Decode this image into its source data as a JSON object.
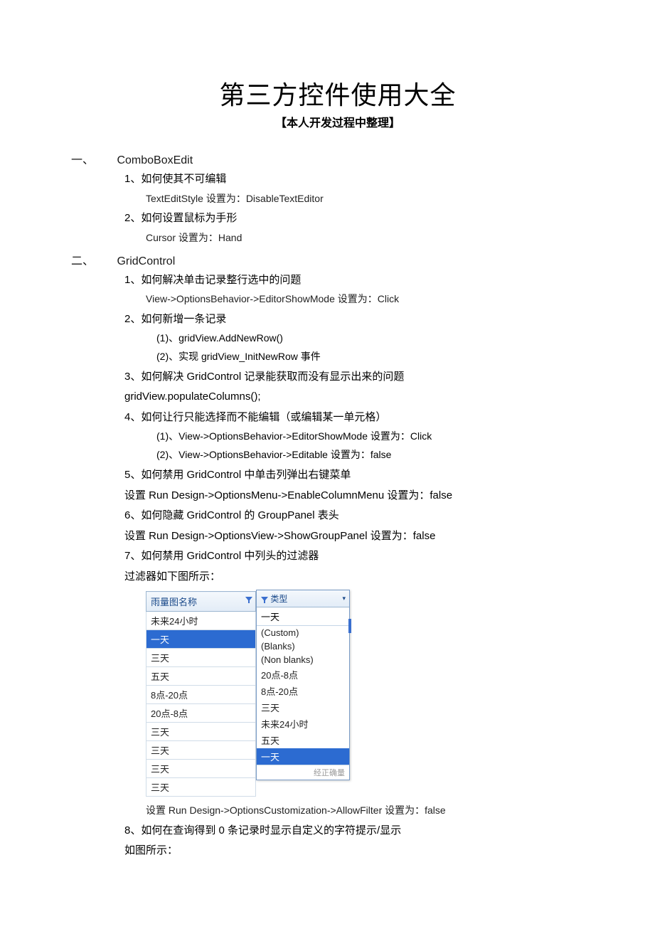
{
  "title": "第三方控件使用大全",
  "subtitle": "【本人开发过程中整理】",
  "sections": [
    {
      "num": "一、",
      "name": "ComboBoxEdit",
      "items": [
        {
          "num": "1、",
          "title": "如何使其不可编辑",
          "details": [
            "TextEditStyle   设置为：DisableTextEditor"
          ]
        },
        {
          "num": "2、",
          "title": "如何设置鼠标为手形",
          "details": [
            "Cursor   设置为：Hand"
          ]
        }
      ]
    },
    {
      "num": "二、",
      "name": "GridControl",
      "items": [
        {
          "num": "1、",
          "title": "如何解决单击记录整行选中的问题",
          "details": [
            "View->OptionsBehavior->EditorShowMode   设置为：Click"
          ]
        },
        {
          "num": "2、",
          "title": "如何新增一条记录",
          "subitems": [
            "(1)、gridView.AddNewRow()",
            "(2)、实现 gridView_InitNewRow 事件"
          ]
        },
        {
          "num": "3、",
          "title": "如何解决 GridControl 记录能获取而没有显示出来的问题",
          "details_at_item_level": [
            "gridView.populateColumns();"
          ]
        },
        {
          "num": "4、",
          "title": "如何让行只能选择而不能编辑（或编辑某一单元格）",
          "subitems": [
            "(1)、View->OptionsBehavior->EditorShowMode   设置为：Click",
            "(2)、View->OptionsBehavior->Editable   设置为：false"
          ]
        },
        {
          "num": "5、",
          "title": "如何禁用 GridControl 中单击列弹出右键菜单",
          "details_at_item_level": [
            "设置 Run  Design->OptionsMenu->EnableColumnMenu   设置为：false"
          ]
        },
        {
          "num": "6、",
          "title": "如何隐藏 GridControl 的 GroupPanel 表头",
          "details_at_item_level": [
            "设置 Run  Design->OptionsView->ShowGroupPanel   设置为：false"
          ]
        },
        {
          "num": "7、",
          "title": "如何禁用 GridControl 中列头的过滤器",
          "details_at_item_level": [
            "过滤器如下图所示："
          ],
          "post_figure": [
            "设置 Run  Design->OptionsCustomization->AllowFilter   设置为：false"
          ]
        },
        {
          "num": "8、",
          "title": "如何在查询得到 0 条记录时显示自定义的字符提示/显示",
          "details_at_item_level": [
            "如图所示："
          ]
        }
      ]
    }
  ],
  "grid": {
    "header": "雨量图名称",
    "rows": [
      "未来24小时",
      "一天",
      "三天",
      "五天",
      "8点-20点",
      "20点-8点",
      "三天",
      "三天",
      "三天",
      "三天"
    ],
    "selected_index": 1
  },
  "popup": {
    "header_label": "类型",
    "input_value": "一天",
    "options": [
      "(Custom)",
      "(Blanks)",
      "(Non blanks)",
      "20点-8点",
      "8点-20点",
      "三天",
      "未来24小时",
      "五天",
      "一天"
    ],
    "selected_index": 8,
    "footer": "经正确量"
  }
}
